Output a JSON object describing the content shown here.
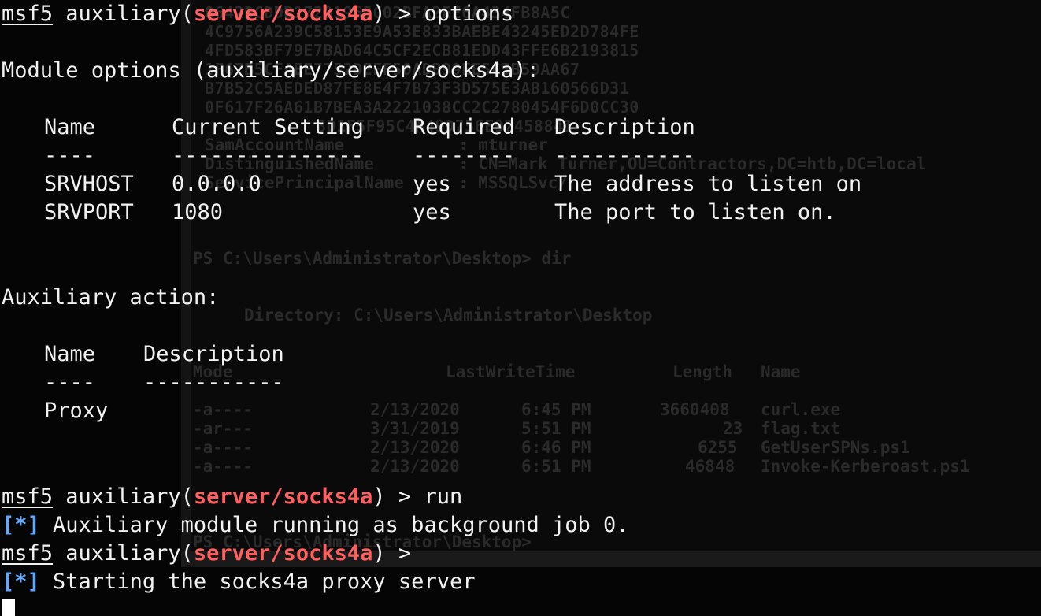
{
  "terminal": {
    "prompt_prefix": "msf5",
    "prompt_module_open": " auxiliary(",
    "prompt_module": "server/socks4a",
    "prompt_module_close": ") > ",
    "cmd_options": "options",
    "cmd_run": "run",
    "module_options_heading": "Module options (auxiliary/server/socks4a):",
    "options_table": {
      "headers": [
        "Name",
        "Current Setting",
        "Required",
        "Description"
      ],
      "dashes": [
        "----",
        "---------------",
        "--------",
        "-----------"
      ],
      "rows": [
        [
          "SRVHOST",
          "0.0.0.0",
          "yes",
          "The address to listen on"
        ],
        [
          "SRVPORT",
          "1080",
          "yes",
          "The port to listen on."
        ]
      ]
    },
    "aux_action_heading": "Auxiliary action:",
    "action_table": {
      "headers": [
        "Name",
        "Description"
      ],
      "dashes": [
        "----",
        "-----------"
      ],
      "rows": [
        [
          "Proxy",
          ""
        ]
      ]
    },
    "status_marker": "[*]",
    "status_running": " Auxiliary module running as background job 0.",
    "status_starting": " Starting the socks4a proxy server"
  },
  "background_terminal": {
    "hex_lines": [
      "0642DCDDB17201965C02BFA2EE6A434FB8A5C",
      "4C9756A239C58153E9A53E833BAEBE43245ED2D784FE",
      "4FD583BF79E7BAD64C5CF2ECB81EDD43FFE6B2193815",
      "1F67B5CFAEE7752DEFF50ADB99EE5C5B59AA67",
      "B7B52C5AEDED87FE8E4F7B73F3D575E3AB160566D31",
      "0F617F26A61B7BEA3A2221038CC2C2780454F6D0CC30",
      "8D1F5F95C4A49D756E97458841"
    ],
    "attrs": [
      [
        "SamAccountName",
        ": mturner"
      ],
      [
        "DistinguishedName",
        ": CN=Mark Turner,OU=Contractors,DC=htb,DC=local"
      ],
      [
        "ServicePrincipalName",
        ": MSSQLSvc/"
      ]
    ],
    "ps_prompt_dir": "PS C:\\Users\\Administrator\\Desktop> dir",
    "directory_heading": "Directory: C:\\Users\\Administrator\\Desktop",
    "dir_headers": [
      "Mode",
      "LastWriteTime",
      "Length",
      "Name"
    ],
    "dir_rows": [
      [
        "-a----",
        "2/13/2020",
        "6:45 PM",
        "3660408",
        "curl.exe"
      ],
      [
        "-ar---",
        "3/31/2019",
        "5:51 PM",
        "23",
        "flag.txt"
      ],
      [
        "-a----",
        "2/13/2020",
        "6:46 PM",
        "6255",
        "GetUserSPNs.ps1"
      ],
      [
        "-a----",
        "2/13/2020",
        "6:51 PM",
        "46848",
        "Invoke-Kerberoast.ps1"
      ]
    ],
    "ps_prompt_last": "PS C:\\Users\\Administrator\\Desktop> "
  }
}
